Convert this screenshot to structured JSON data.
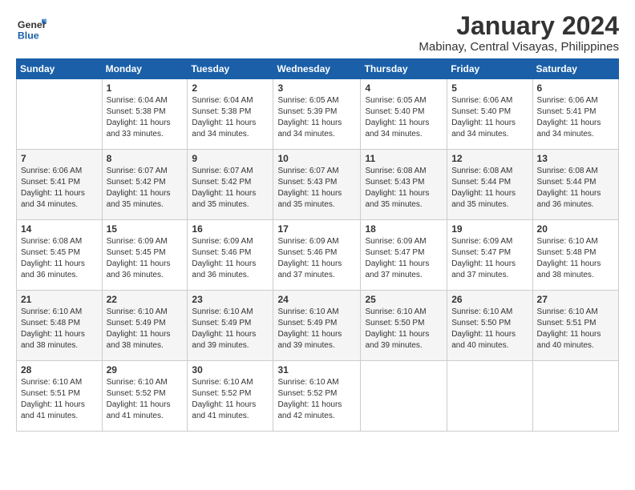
{
  "logo": {
    "text_general": "General",
    "text_blue": "Blue"
  },
  "header": {
    "month_year": "January 2024",
    "location": "Mabinay, Central Visayas, Philippines"
  },
  "weekdays": [
    "Sunday",
    "Monday",
    "Tuesday",
    "Wednesday",
    "Thursday",
    "Friday",
    "Saturday"
  ],
  "weeks": [
    [
      {
        "day": "",
        "sunrise": "",
        "sunset": "",
        "daylight": ""
      },
      {
        "day": "1",
        "sunrise": "Sunrise: 6:04 AM",
        "sunset": "Sunset: 5:38 PM",
        "daylight": "Daylight: 11 hours and 33 minutes."
      },
      {
        "day": "2",
        "sunrise": "Sunrise: 6:04 AM",
        "sunset": "Sunset: 5:38 PM",
        "daylight": "Daylight: 11 hours and 34 minutes."
      },
      {
        "day": "3",
        "sunrise": "Sunrise: 6:05 AM",
        "sunset": "Sunset: 5:39 PM",
        "daylight": "Daylight: 11 hours and 34 minutes."
      },
      {
        "day": "4",
        "sunrise": "Sunrise: 6:05 AM",
        "sunset": "Sunset: 5:40 PM",
        "daylight": "Daylight: 11 hours and 34 minutes."
      },
      {
        "day": "5",
        "sunrise": "Sunrise: 6:06 AM",
        "sunset": "Sunset: 5:40 PM",
        "daylight": "Daylight: 11 hours and 34 minutes."
      },
      {
        "day": "6",
        "sunrise": "Sunrise: 6:06 AM",
        "sunset": "Sunset: 5:41 PM",
        "daylight": "Daylight: 11 hours and 34 minutes."
      }
    ],
    [
      {
        "day": "7",
        "sunrise": "Sunrise: 6:06 AM",
        "sunset": "Sunset: 5:41 PM",
        "daylight": "Daylight: 11 hours and 34 minutes."
      },
      {
        "day": "8",
        "sunrise": "Sunrise: 6:07 AM",
        "sunset": "Sunset: 5:42 PM",
        "daylight": "Daylight: 11 hours and 35 minutes."
      },
      {
        "day": "9",
        "sunrise": "Sunrise: 6:07 AM",
        "sunset": "Sunset: 5:42 PM",
        "daylight": "Daylight: 11 hours and 35 minutes."
      },
      {
        "day": "10",
        "sunrise": "Sunrise: 6:07 AM",
        "sunset": "Sunset: 5:43 PM",
        "daylight": "Daylight: 11 hours and 35 minutes."
      },
      {
        "day": "11",
        "sunrise": "Sunrise: 6:08 AM",
        "sunset": "Sunset: 5:43 PM",
        "daylight": "Daylight: 11 hours and 35 minutes."
      },
      {
        "day": "12",
        "sunrise": "Sunrise: 6:08 AM",
        "sunset": "Sunset: 5:44 PM",
        "daylight": "Daylight: 11 hours and 35 minutes."
      },
      {
        "day": "13",
        "sunrise": "Sunrise: 6:08 AM",
        "sunset": "Sunset: 5:44 PM",
        "daylight": "Daylight: 11 hours and 36 minutes."
      }
    ],
    [
      {
        "day": "14",
        "sunrise": "Sunrise: 6:08 AM",
        "sunset": "Sunset: 5:45 PM",
        "daylight": "Daylight: 11 hours and 36 minutes."
      },
      {
        "day": "15",
        "sunrise": "Sunrise: 6:09 AM",
        "sunset": "Sunset: 5:45 PM",
        "daylight": "Daylight: 11 hours and 36 minutes."
      },
      {
        "day": "16",
        "sunrise": "Sunrise: 6:09 AM",
        "sunset": "Sunset: 5:46 PM",
        "daylight": "Daylight: 11 hours and 36 minutes."
      },
      {
        "day": "17",
        "sunrise": "Sunrise: 6:09 AM",
        "sunset": "Sunset: 5:46 PM",
        "daylight": "Daylight: 11 hours and 37 minutes."
      },
      {
        "day": "18",
        "sunrise": "Sunrise: 6:09 AM",
        "sunset": "Sunset: 5:47 PM",
        "daylight": "Daylight: 11 hours and 37 minutes."
      },
      {
        "day": "19",
        "sunrise": "Sunrise: 6:09 AM",
        "sunset": "Sunset: 5:47 PM",
        "daylight": "Daylight: 11 hours and 37 minutes."
      },
      {
        "day": "20",
        "sunrise": "Sunrise: 6:10 AM",
        "sunset": "Sunset: 5:48 PM",
        "daylight": "Daylight: 11 hours and 38 minutes."
      }
    ],
    [
      {
        "day": "21",
        "sunrise": "Sunrise: 6:10 AM",
        "sunset": "Sunset: 5:48 PM",
        "daylight": "Daylight: 11 hours and 38 minutes."
      },
      {
        "day": "22",
        "sunrise": "Sunrise: 6:10 AM",
        "sunset": "Sunset: 5:49 PM",
        "daylight": "Daylight: 11 hours and 38 minutes."
      },
      {
        "day": "23",
        "sunrise": "Sunrise: 6:10 AM",
        "sunset": "Sunset: 5:49 PM",
        "daylight": "Daylight: 11 hours and 39 minutes."
      },
      {
        "day": "24",
        "sunrise": "Sunrise: 6:10 AM",
        "sunset": "Sunset: 5:49 PM",
        "daylight": "Daylight: 11 hours and 39 minutes."
      },
      {
        "day": "25",
        "sunrise": "Sunrise: 6:10 AM",
        "sunset": "Sunset: 5:50 PM",
        "daylight": "Daylight: 11 hours and 39 minutes."
      },
      {
        "day": "26",
        "sunrise": "Sunrise: 6:10 AM",
        "sunset": "Sunset: 5:50 PM",
        "daylight": "Daylight: 11 hours and 40 minutes."
      },
      {
        "day": "27",
        "sunrise": "Sunrise: 6:10 AM",
        "sunset": "Sunset: 5:51 PM",
        "daylight": "Daylight: 11 hours and 40 minutes."
      }
    ],
    [
      {
        "day": "28",
        "sunrise": "Sunrise: 6:10 AM",
        "sunset": "Sunset: 5:51 PM",
        "daylight": "Daylight: 11 hours and 41 minutes."
      },
      {
        "day": "29",
        "sunrise": "Sunrise: 6:10 AM",
        "sunset": "Sunset: 5:52 PM",
        "daylight": "Daylight: 11 hours and 41 minutes."
      },
      {
        "day": "30",
        "sunrise": "Sunrise: 6:10 AM",
        "sunset": "Sunset: 5:52 PM",
        "daylight": "Daylight: 11 hours and 41 minutes."
      },
      {
        "day": "31",
        "sunrise": "Sunrise: 6:10 AM",
        "sunset": "Sunset: 5:52 PM",
        "daylight": "Daylight: 11 hours and 42 minutes."
      },
      {
        "day": "",
        "sunrise": "",
        "sunset": "",
        "daylight": ""
      },
      {
        "day": "",
        "sunrise": "",
        "sunset": "",
        "daylight": ""
      },
      {
        "day": "",
        "sunrise": "",
        "sunset": "",
        "daylight": ""
      }
    ]
  ]
}
